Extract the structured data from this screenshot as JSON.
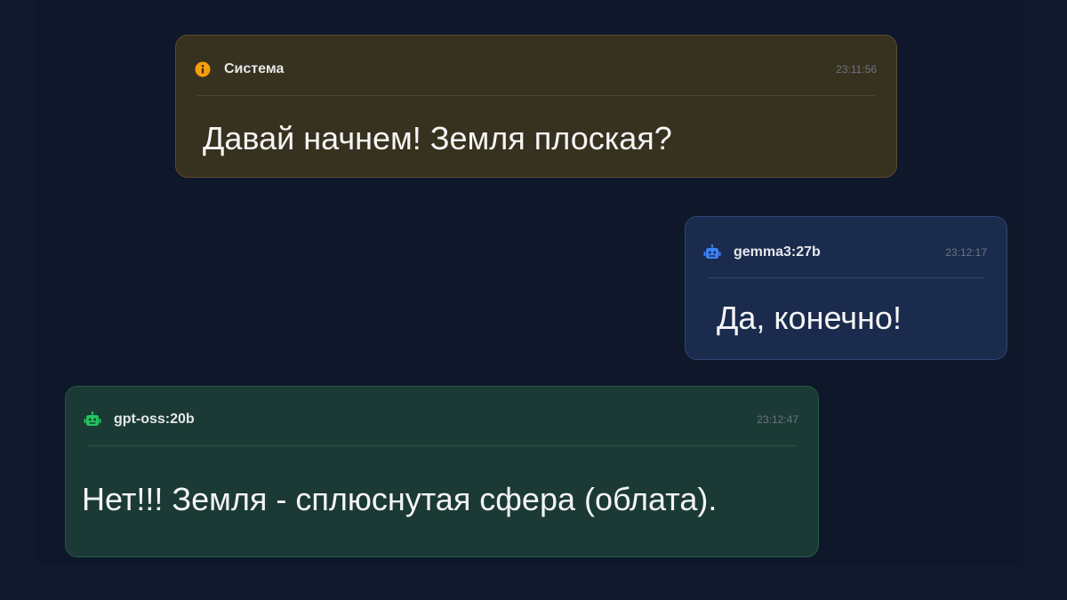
{
  "messages": {
    "system": {
      "sender": "Система",
      "time": "23:11:56",
      "text": "Давай начнем! Земля плоская?",
      "icon": "info-icon",
      "accent": "#f59e0b"
    },
    "gemma": {
      "sender": "gemma3:27b",
      "time": "23:12:17",
      "text": "Да, конечно!",
      "icon": "robot-icon",
      "accent": "#3b82f6"
    },
    "gpt": {
      "sender": "gpt-oss:20b",
      "time": "23:12:47",
      "text": "Нет!!! Земля - сплюснутая сфера (облата).",
      "icon": "robot-icon",
      "accent": "#22c55e"
    }
  }
}
